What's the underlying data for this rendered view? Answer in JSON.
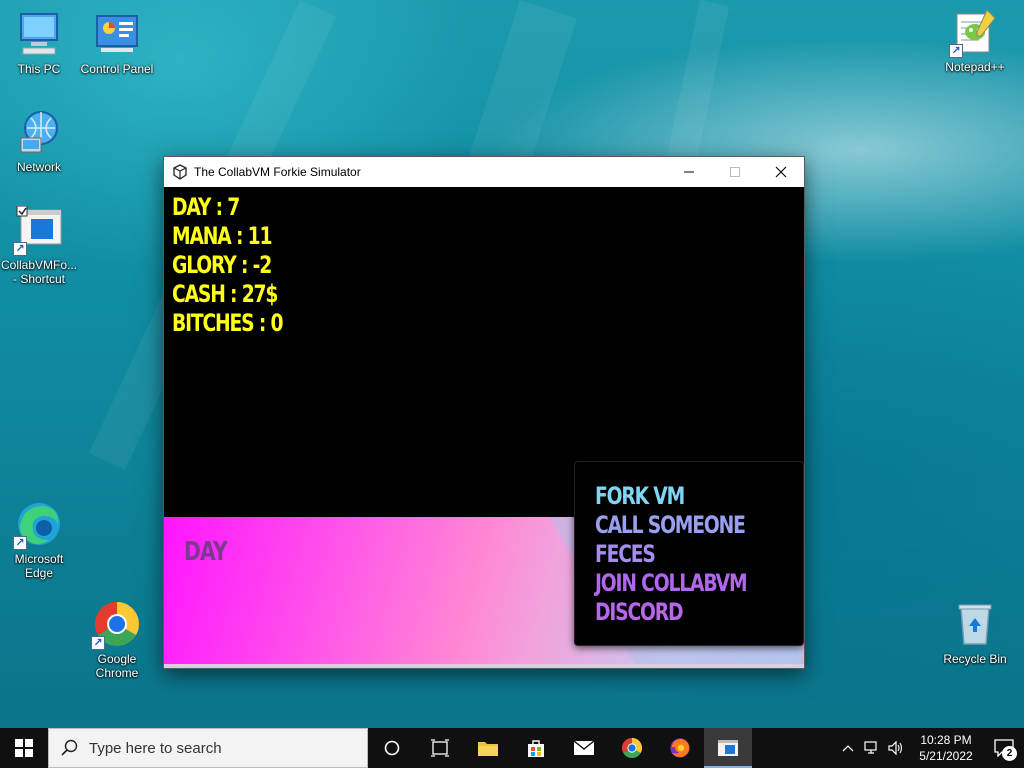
{
  "desktop": {
    "icons": [
      {
        "label": "This PC",
        "icon": "computer-icon"
      },
      {
        "label": "Control Panel",
        "icon": "control-panel-icon"
      },
      {
        "label": "Network",
        "icon": "network-icon"
      },
      {
        "label": "CollabVMFo... - Shortcut",
        "icon": "collabvm-shortcut-icon"
      },
      {
        "label": "Microsoft Edge",
        "icon": "edge-icon"
      },
      {
        "label": "Google Chrome",
        "icon": "chrome-icon"
      },
      {
        "label": "Notepad++",
        "icon": "notepadpp-icon"
      },
      {
        "label": "Recycle Bin",
        "icon": "recycle-bin-icon"
      }
    ]
  },
  "window": {
    "title": "The CollabVM Forkie Simulator",
    "stats": [
      "DAY : 7",
      "MANA : 11",
      "GLORY : -2",
      "CASH : 27$",
      "BITCHES : 0"
    ],
    "phase_label": "DAY",
    "menu": [
      {
        "label": "FORK VM",
        "color": "#7fd6f4"
      },
      {
        "label": "CALL SOMEONE",
        "color": "#9aa0f0"
      },
      {
        "label": "FECES",
        "color": "#a48cf0"
      },
      {
        "label": "JOIN COLLABVM",
        "color": "#b066ee"
      },
      {
        "label": "DISCORD",
        "color": "#b866ee"
      }
    ]
  },
  "taskbar": {
    "search_placeholder": "Type here to search",
    "time": "10:28 PM",
    "date": "5/21/2022",
    "notification_count": "2"
  },
  "colors": {
    "stat_yellow": "#ffff1a",
    "phase_purple": "#7a3a90",
    "taskbar": "#101010"
  }
}
